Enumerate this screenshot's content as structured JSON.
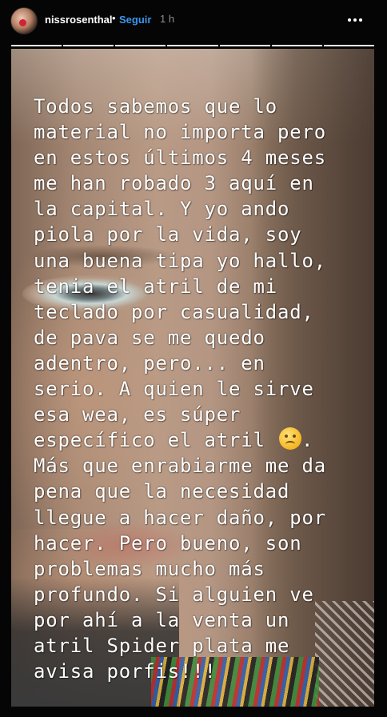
{
  "header": {
    "username": "nissrosenthal",
    "separator": "•",
    "follow_label": "Seguir",
    "time": "1 h",
    "more_icon": "more-options-icon"
  },
  "progress": {
    "segments": 7
  },
  "story": {
    "lines": [
      "Todos sabemos que lo",
      "material no importa pero",
      "en estos últimos 4 meses",
      "me han robado 3 aquí en",
      "la capital. Y yo ando",
      "piola por la vida, soy",
      "una buena tipa yo hallo,",
      "tenia el atril de mi",
      "teclado por casualidad,",
      "de pava se me quedo",
      "adentro, pero... en",
      "serio. A quien le sirve",
      "esa wea, es súper",
      "específico el atril",
      "Más que enrabiarme me da",
      "pena que la necesidad",
      "llegue a hacer daño, por",
      "hacer. Pero bueno, son",
      "problemas mucho más",
      "profundo. Si alguien ve",
      "por ahí a la venta un",
      "atril Spider plata me",
      "avisa porfis!!!"
    ],
    "emoji": "worried-face-emoji",
    "line14_suffix": "."
  }
}
